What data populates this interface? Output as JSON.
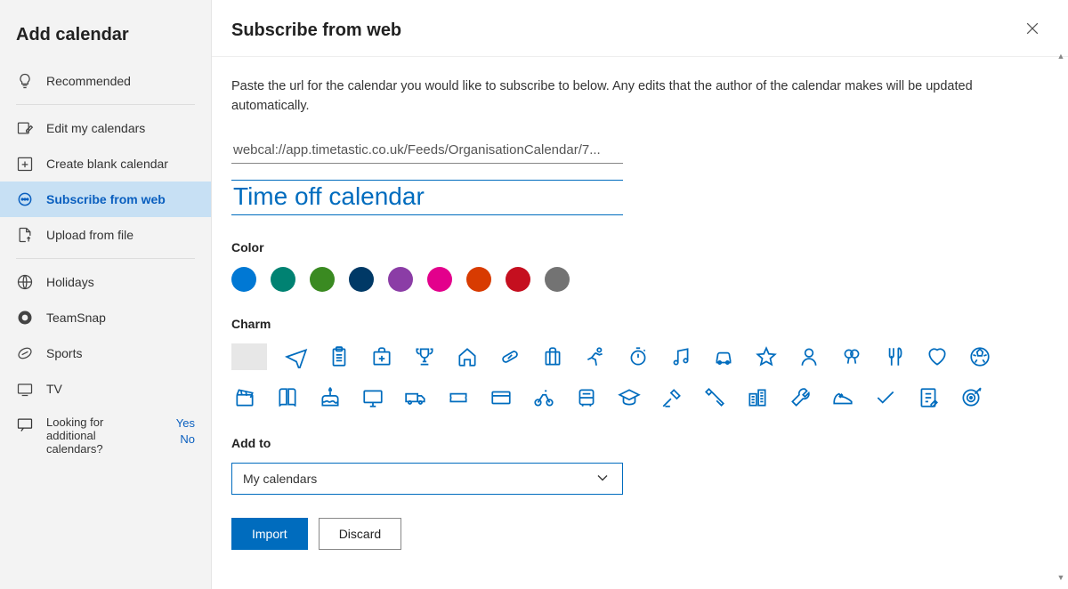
{
  "sidebar": {
    "title": "Add calendar",
    "items": [
      {
        "label": "Recommended",
        "icon": "lightbulb"
      },
      {
        "label": "Edit my calendars",
        "icon": "edit-cal"
      },
      {
        "label": "Create blank calendar",
        "icon": "plus-box"
      },
      {
        "label": "Subscribe from web",
        "icon": "link",
        "active": true
      },
      {
        "label": "Upload from file",
        "icon": "file-upload"
      },
      {
        "label": "Holidays",
        "icon": "globe"
      },
      {
        "label": "TeamSnap",
        "icon": "teamsnap"
      },
      {
        "label": "Sports",
        "icon": "football"
      },
      {
        "label": "TV",
        "icon": "tv"
      }
    ],
    "feedback": {
      "icon": "feedback",
      "label": "Looking for additional calendars?",
      "yes": "Yes",
      "no": "No"
    }
  },
  "main": {
    "title": "Subscribe from web",
    "description": "Paste the url for the calendar you would like to subscribe to below. Any edits that the author of the calendar makes will be updated automatically.",
    "url": "webcal://app.timetastic.co.uk/Feeds/OrganisationCalendar/7...",
    "name": "Time off calendar",
    "color_label": "Color",
    "colors": [
      "#0078d4",
      "#008272",
      "#3a8a21",
      "#003966",
      "#8b3da6",
      "#e3008c",
      "#d83b01",
      "#c50f1f",
      "#737373"
    ],
    "charm_label": "Charm",
    "addto_label": "Add to",
    "addto_value": "My calendars",
    "import_btn": "Import",
    "discard_btn": "Discard"
  }
}
